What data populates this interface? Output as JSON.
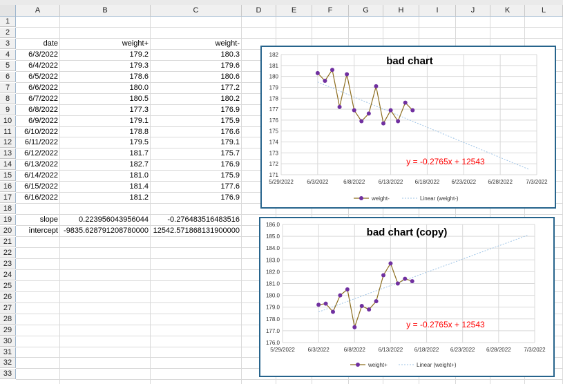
{
  "columns": [
    "A",
    "B",
    "C",
    "D",
    "E",
    "F",
    "G",
    "H",
    "I",
    "J",
    "K",
    "L"
  ],
  "rows": [
    1,
    2,
    3,
    4,
    5,
    6,
    7,
    8,
    9,
    10,
    11,
    12,
    13,
    14,
    15,
    16,
    17,
    18,
    19,
    20,
    21,
    22,
    23,
    24,
    25,
    26,
    27,
    28,
    29,
    30,
    31,
    32,
    33
  ],
  "headers": {
    "date": "date",
    "plus": "weight+",
    "minus": "weight-"
  },
  "table": [
    {
      "date": "6/3/2022",
      "plus": "179.2",
      "minus": "180.3"
    },
    {
      "date": "6/4/2022",
      "plus": "179.3",
      "minus": "179.6"
    },
    {
      "date": "6/5/2022",
      "plus": "178.6",
      "minus": "180.6"
    },
    {
      "date": "6/6/2022",
      "plus": "180.0",
      "minus": "177.2"
    },
    {
      "date": "6/7/2022",
      "plus": "180.5",
      "minus": "180.2"
    },
    {
      "date": "6/8/2022",
      "plus": "177.3",
      "minus": "176.9"
    },
    {
      "date": "6/9/2022",
      "plus": "179.1",
      "minus": "175.9"
    },
    {
      "date": "6/10/2022",
      "plus": "178.8",
      "minus": "176.6"
    },
    {
      "date": "6/11/2022",
      "plus": "179.5",
      "minus": "179.1"
    },
    {
      "date": "6/12/2022",
      "plus": "181.7",
      "minus": "175.7"
    },
    {
      "date": "6/13/2022",
      "plus": "182.7",
      "minus": "176.9"
    },
    {
      "date": "6/14/2022",
      "plus": "181.0",
      "minus": "175.9"
    },
    {
      "date": "6/15/2022",
      "plus": "181.4",
      "minus": "177.6"
    },
    {
      "date": "6/16/2022",
      "plus": "181.2",
      "minus": "176.9"
    }
  ],
  "stats": [
    {
      "label": "slope",
      "plus": "0.223956043956044",
      "minus": "-0.276483516483516"
    },
    {
      "label": "intercept",
      "plus": "-9835.628791208780000",
      "minus": "12542.571868131900000"
    }
  ],
  "charts": [
    {
      "title": "bad chart",
      "series_name": "weight-",
      "trend_name": "Linear (weight-)",
      "equation": "y = -0.2765x + 12543",
      "y_ticks": [
        "182",
        "181",
        "180",
        "179",
        "178",
        "177",
        "176",
        "175",
        "174",
        "173",
        "172",
        "171"
      ],
      "x_ticks": [
        "5/29/2022",
        "6/3/2022",
        "6/8/2022",
        "6/13/2022",
        "6/18/2022",
        "6/23/2022",
        "6/28/2022",
        "7/3/2022"
      ],
      "colors": {
        "series": "#7030a0",
        "line": "#8c6d1f",
        "trend": "#9dc3e6",
        "equation": "#ff0000",
        "border": "#27648c"
      }
    },
    {
      "title": "bad chart (copy)",
      "series_name": "weight+",
      "trend_name": "Linear (weight+)",
      "equation": "y = -0.2765x + 12543",
      "y_ticks": [
        "186.0",
        "185.0",
        "184.0",
        "183.0",
        "182.0",
        "181.0",
        "180.0",
        "179.0",
        "178.0",
        "177.0",
        "176.0"
      ],
      "x_ticks": [
        "5/29/2022",
        "6/3/2022",
        "6/8/2022",
        "6/13/2022",
        "6/18/2022",
        "6/23/2022",
        "6/28/2022",
        "7/3/2022"
      ],
      "colors": {
        "series": "#7030a0",
        "line": "#8c6d1f",
        "trend": "#9dc3e6",
        "equation": "#ff0000",
        "border": "#27648c"
      }
    }
  ],
  "chart_data": [
    {
      "type": "line",
      "title": "bad chart",
      "xlabel": "",
      "ylabel": "",
      "x": [
        "6/3/2022",
        "6/4/2022",
        "6/5/2022",
        "6/6/2022",
        "6/7/2022",
        "6/8/2022",
        "6/9/2022",
        "6/10/2022",
        "6/11/2022",
        "6/12/2022",
        "6/13/2022",
        "6/14/2022",
        "6/15/2022",
        "6/16/2022"
      ],
      "series": [
        {
          "name": "weight-",
          "values": [
            180.3,
            179.6,
            180.6,
            177.2,
            180.2,
            176.9,
            175.9,
            176.6,
            179.1,
            175.7,
            176.9,
            175.9,
            177.6,
            176.9
          ]
        }
      ],
      "trendline": {
        "name": "Linear (weight-)",
        "x_start": "6/3/2022",
        "x_end": "7/2/2022",
        "slope_per_day": -0.276483516483516,
        "start_value": 179.49
      },
      "xlim": [
        "5/29/2022",
        "7/3/2022"
      ],
      "ylim": [
        171,
        182
      ],
      "grid": true,
      "legend": "bottom"
    },
    {
      "type": "line",
      "title": "bad chart (copy)",
      "xlabel": "",
      "ylabel": "",
      "x": [
        "6/3/2022",
        "6/4/2022",
        "6/5/2022",
        "6/6/2022",
        "6/7/2022",
        "6/8/2022",
        "6/9/2022",
        "6/10/2022",
        "6/11/2022",
        "6/12/2022",
        "6/13/2022",
        "6/14/2022",
        "6/15/2022",
        "6/16/2022"
      ],
      "series": [
        {
          "name": "weight+",
          "values": [
            179.2,
            179.3,
            178.6,
            180.0,
            180.5,
            177.3,
            179.1,
            178.8,
            179.5,
            181.7,
            182.7,
            181.0,
            181.4,
            181.2
          ]
        }
      ],
      "trendline": {
        "name": "Linear (weight+)",
        "x_start": "6/3/2022",
        "x_end": "7/2/2022",
        "slope_per_day": 0.223956043956044,
        "start_value": 178.59
      },
      "xlim": [
        "5/29/2022",
        "7/3/2022"
      ],
      "ylim": [
        176,
        186
      ],
      "grid": true,
      "legend": "bottom"
    }
  ]
}
